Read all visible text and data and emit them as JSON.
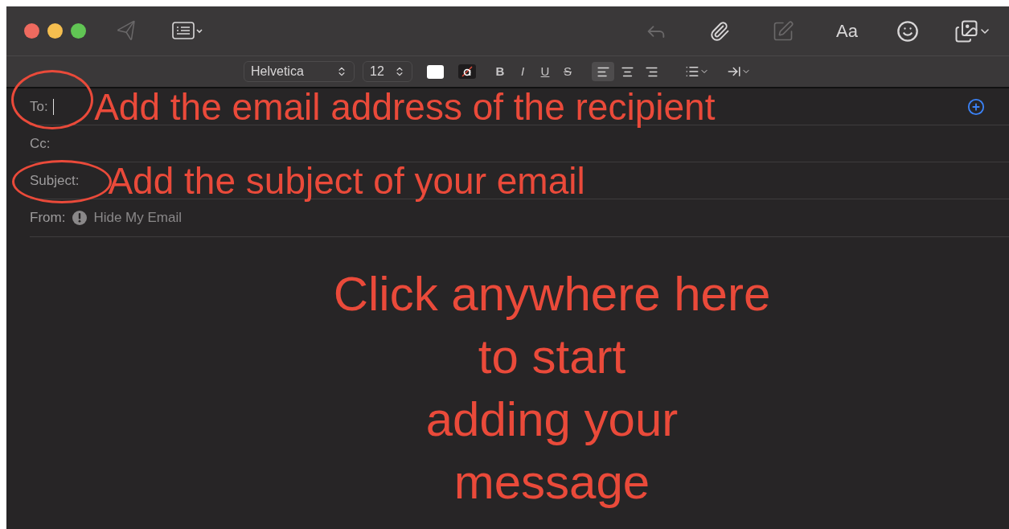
{
  "toolbar": [
    {
      "disabled": true
    },
    {
      "disabled": false
    },
    {
      "disabled": true
    },
    {
      "disabled": false
    },
    {
      "disabled": true
    },
    {
      "disabled": false
    },
    {
      "disabled": false
    },
    {
      "disabled": false
    }
  ],
  "format_bar": {
    "font": "Helvetica",
    "size": "12",
    "styles": [
      "B",
      "I",
      "U",
      "S"
    ],
    "alignments": [
      {
        "selected": true
      },
      {
        "selected": false
      },
      {
        "selected": false
      }
    ]
  },
  "font_button": "Aa",
  "fields": [
    {
      "label": "To:",
      "focused": true,
      "annotation": "Add the email address of the recipient",
      "circled": true
    },
    {
      "label": "Cc:",
      "focused": false,
      "circled": false
    },
    {
      "label": "Subject:",
      "focused": false,
      "annotation": "Add the subject of your email",
      "circled": true
    }
  ],
  "from": {
    "label": "From:",
    "value": "Hide My Email"
  },
  "body_annotation": [
    "Click anywhere here",
    "to start",
    "adding your",
    "message"
  ]
}
